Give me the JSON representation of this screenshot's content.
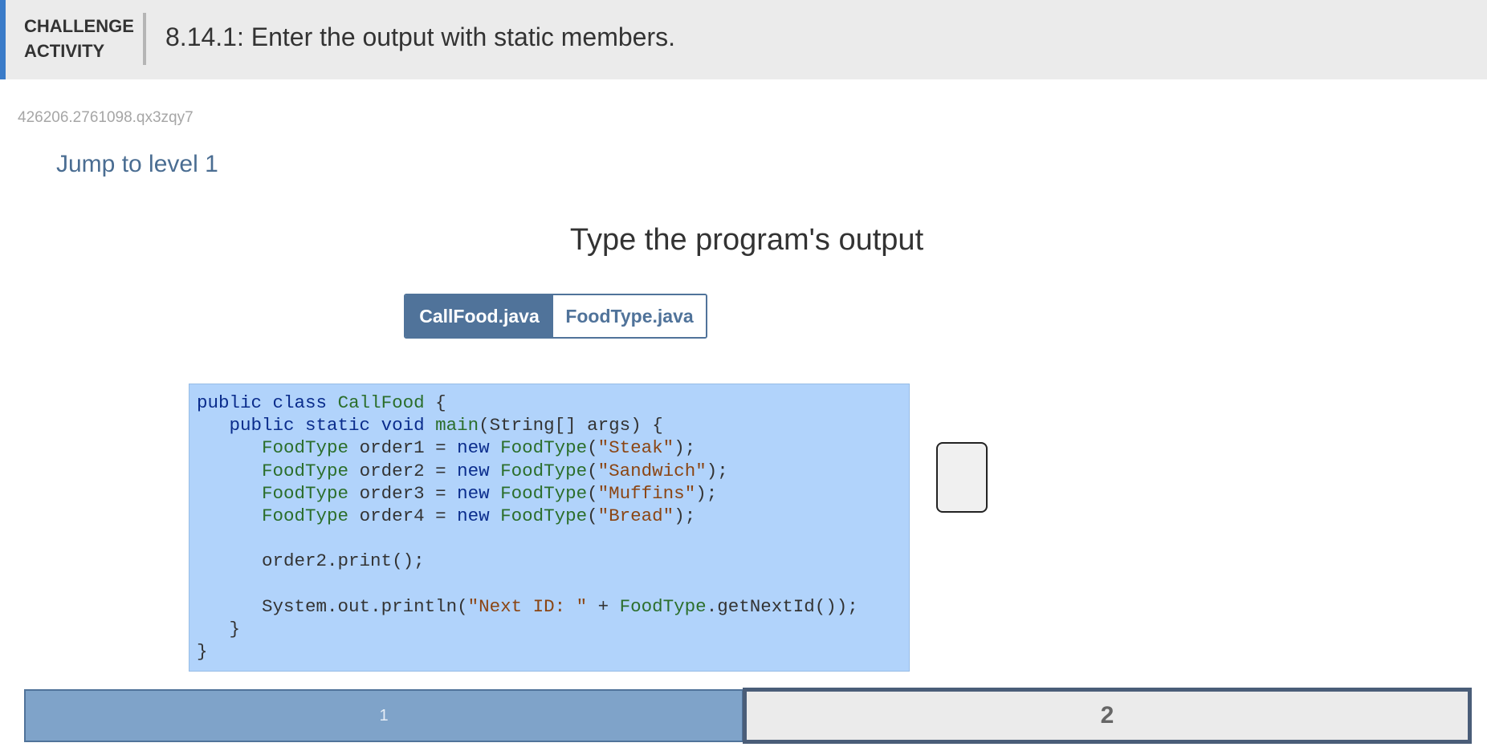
{
  "header": {
    "label": "CHALLENGE ACTIVITY",
    "title": "8.14.1: Enter the output with static members."
  },
  "activity_id": "426206.2761098.qx3zqy7",
  "jump_link": "Jump to level 1",
  "prompt": "Type the program's output",
  "tabs": [
    {
      "label": "CallFood.java",
      "active": true
    },
    {
      "label": "FoodType.java",
      "active": false
    }
  ],
  "code": {
    "file": "CallFood.java",
    "lines": [
      "public class CallFood {",
      "   public static void main(String[] args) {",
      "      FoodType order1 = new FoodType(\"Steak\");",
      "      FoodType order2 = new FoodType(\"Sandwich\");",
      "      FoodType order3 = new FoodType(\"Muffins\");",
      "      FoodType order4 = new FoodType(\"Bread\");",
      "",
      "      order2.print();",
      "",
      "      System.out.println(\"Next ID: \" + FoodType.getNextId());",
      "   }",
      "}"
    ]
  },
  "answer_value": "",
  "levels": [
    {
      "label": "1",
      "state": "completed"
    },
    {
      "label": "2",
      "state": "current"
    }
  ],
  "colors": {
    "accent": "#3a7bc8",
    "tab_active": "#50739a",
    "code_background": "#b1d3fb",
    "level_completed": "#7fa3c9",
    "level_current_border": "#4a5d78"
  }
}
